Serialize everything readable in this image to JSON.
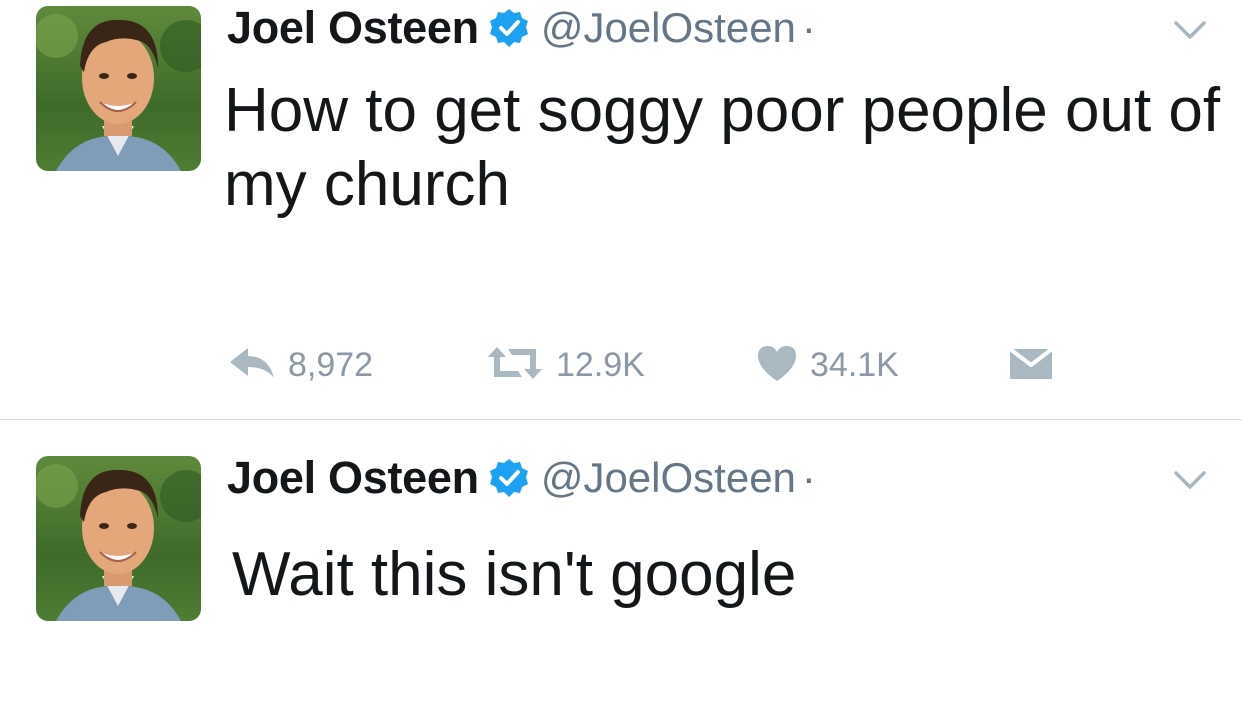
{
  "tweets": [
    {
      "author": {
        "name": "Joel Osteen",
        "handle": "@JoelOsteen",
        "separator": "·",
        "verified": true
      },
      "text": "How to get soggy poor people out of my church",
      "actions": {
        "replies": "8,972",
        "retweets": "12.9K",
        "likes": "34.1K"
      }
    },
    {
      "author": {
        "name": "Joel Osteen",
        "handle": "@JoelOsteen",
        "separator": "·",
        "verified": true
      },
      "text": "Wait this isn't google"
    }
  ],
  "colors": {
    "verified_badge": "#1da1f2",
    "action_icon": "#aab8c2",
    "handle": "#657786",
    "divider": "#d9dde0"
  },
  "icons": [
    "reply-icon",
    "retweet-icon",
    "like-icon",
    "direct-message-icon",
    "caret-down-icon",
    "verified-badge-icon"
  ]
}
